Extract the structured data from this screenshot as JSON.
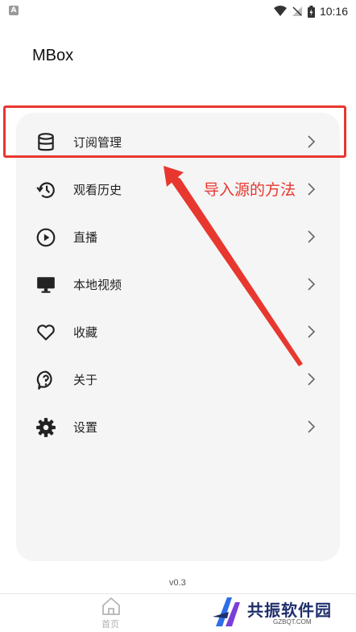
{
  "status_bar": {
    "app_badge": "A",
    "time": "10:16"
  },
  "app": {
    "title": "MBox"
  },
  "menu": {
    "items": [
      {
        "label": "订阅管理",
        "icon": "database-icon"
      },
      {
        "label": "观看历史",
        "icon": "history-icon"
      },
      {
        "label": "直播",
        "icon": "play-circle-icon"
      },
      {
        "label": "本地视频",
        "icon": "monitor-icon"
      },
      {
        "label": "收藏",
        "icon": "heart-icon"
      },
      {
        "label": "关于",
        "icon": "help-icon"
      },
      {
        "label": "设置",
        "icon": "gear-icon"
      }
    ]
  },
  "annotation": {
    "text": "导入源的方法",
    "color": "#e8372f"
  },
  "footer": {
    "version": "v0.3",
    "home_label": "首页"
  },
  "watermark": {
    "text": "共振软件园",
    "sub": "GZBQT.COM"
  }
}
